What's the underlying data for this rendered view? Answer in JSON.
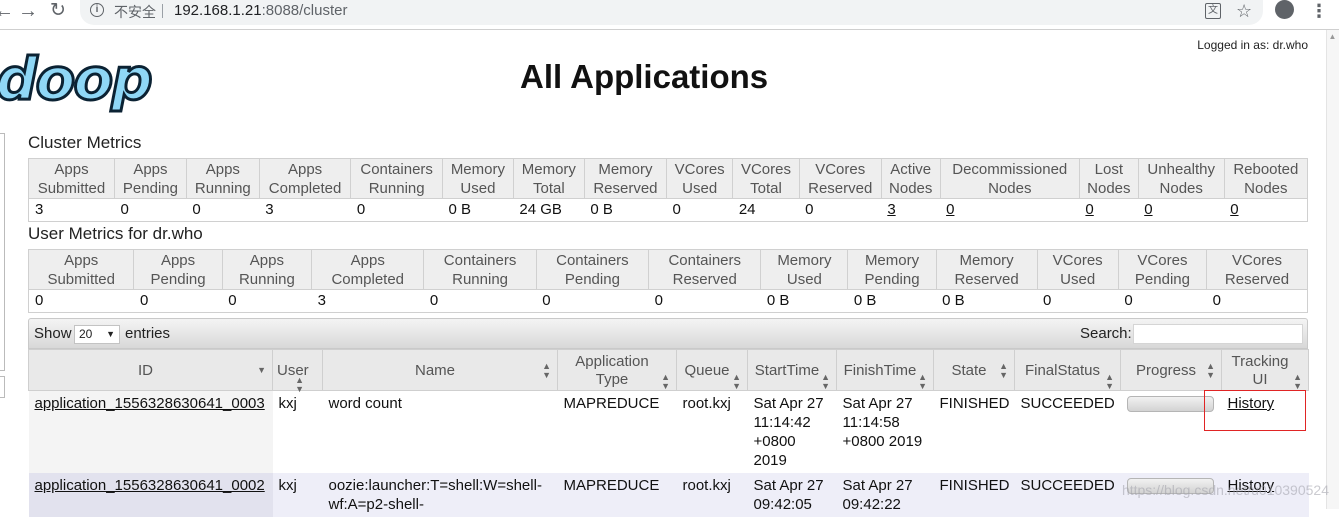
{
  "browser": {
    "back_icon": "arrow-left-icon",
    "forward_icon": "arrow-right-icon",
    "reload_icon": "reload-icon",
    "security_label": "不安全",
    "url_host": "192.168.1.21",
    "url_rest": ":8088/cluster"
  },
  "header": {
    "logo_text": "doop",
    "logged_in": "Logged in as: dr.who",
    "title": "All Applications"
  },
  "cluster_metrics": {
    "title": "Cluster Metrics",
    "headers": [
      [
        "Apps",
        "Submitted"
      ],
      [
        "Apps",
        "Pending"
      ],
      [
        "Apps",
        "Running"
      ],
      [
        "Apps",
        "Completed"
      ],
      [
        "Containers",
        "Running"
      ],
      [
        "Memory",
        "Used"
      ],
      [
        "Memory",
        "Total"
      ],
      [
        "Memory",
        "Reserved"
      ],
      [
        "VCores",
        "Used"
      ],
      [
        "VCores",
        "Total"
      ],
      [
        "VCores",
        "Reserved"
      ],
      [
        "Active",
        "Nodes"
      ],
      [
        "Decommissioned",
        "Nodes"
      ],
      [
        "Lost",
        "Nodes"
      ],
      [
        "Unhealthy",
        "Nodes"
      ],
      [
        "Rebooted",
        "Nodes"
      ]
    ],
    "values": [
      "3",
      "0",
      "0",
      "3",
      "0",
      "0 B",
      "24 GB",
      "0 B",
      "0",
      "24",
      "0",
      "3",
      "0",
      "0",
      "0",
      "0"
    ]
  },
  "user_metrics": {
    "title": "User Metrics for dr.who",
    "headers": [
      [
        "Apps",
        "Submitted"
      ],
      [
        "Apps",
        "Pending"
      ],
      [
        "Apps",
        "Running"
      ],
      [
        "Apps",
        "Completed"
      ],
      [
        "Containers",
        "Running"
      ],
      [
        "Containers",
        "Pending"
      ],
      [
        "Containers",
        "Reserved"
      ],
      [
        "Memory",
        "Used"
      ],
      [
        "Memory",
        "Pending"
      ],
      [
        "Memory",
        "Reserved"
      ],
      [
        "VCores",
        "Used"
      ],
      [
        "VCores",
        "Pending"
      ],
      [
        "VCores",
        "Reserved"
      ]
    ],
    "values": [
      "0",
      "0",
      "0",
      "3",
      "0",
      "0",
      "0",
      "0 B",
      "0 B",
      "0 B",
      "0",
      "0",
      "0"
    ]
  },
  "datatable": {
    "show_label": "Show",
    "page_size": "20",
    "entries_label": "entries",
    "search_label": "Search:",
    "columns": [
      "ID",
      "User",
      "Name",
      "Application Type",
      "Queue",
      "StartTime",
      "FinishTime",
      "State",
      "FinalStatus",
      "Progress",
      "Tracking UI"
    ],
    "rows": [
      {
        "id": "application_1556328630641_0003",
        "user": "kxj",
        "name": "word count",
        "type": "MAPREDUCE",
        "queue": "root.kxj",
        "start": "Sat Apr 27 11:14:42 +0800 2019",
        "finish": "Sat Apr 27 11:14:58 +0800 2019",
        "state": "FINISHED",
        "final_status": "SUCCEEDED",
        "progress": 1.0,
        "tracking": "History"
      },
      {
        "id": "application_1556328630641_0002",
        "user": "kxj",
        "name": "oozie:launcher:T=shell:W=shell-wf:A=p2-shell-",
        "type": "MAPREDUCE",
        "queue": "root.kxj",
        "start": "Sat Apr 27 09:42:05",
        "finish": "Sat Apr 27 09:42:22",
        "state": "FINISHED",
        "final_status": "SUCCEEDED",
        "progress": 1.0,
        "tracking": "History"
      }
    ]
  },
  "watermark": "https://blog.csdn.net/u010390524"
}
